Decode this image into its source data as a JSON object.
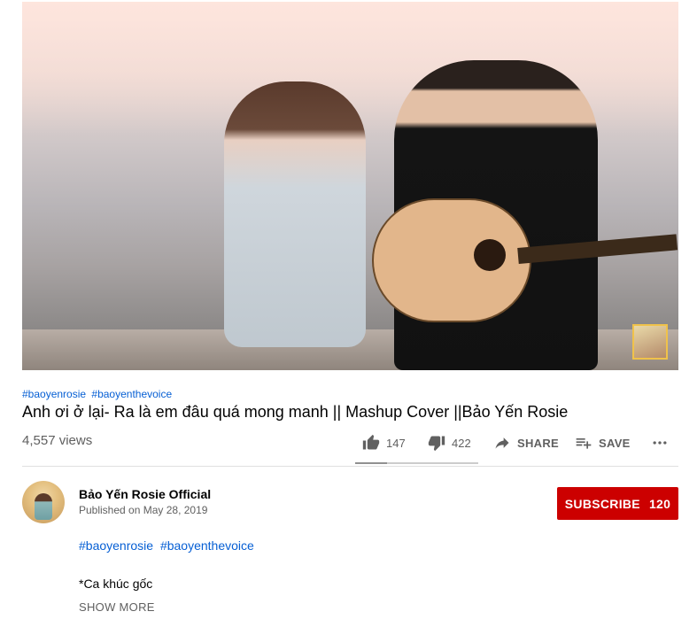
{
  "video": {
    "hashtags": [
      "#baoyenrosie",
      "#baoyenthevoice"
    ],
    "title": "Anh ơi ở lại- Ra là em đâu quá mong manh || Mashup Cover ||Bảo Yến Rosie",
    "views": "4,557 views"
  },
  "actions": {
    "like_icon": "thumb-up-icon",
    "like_count": "147",
    "dislike_icon": "thumb-down-icon",
    "dislike_count": "422",
    "share_icon": "share-icon",
    "share_label": "SHARE",
    "save_icon": "playlist-add-icon",
    "save_label": "SAVE",
    "more_icon": "more-horizontal-icon",
    "like_ratio": 0.26
  },
  "channel": {
    "name": "Bảo Yến Rosie Official",
    "published": "Published on May 28, 2019",
    "subscribe_label": "SUBSCRIBE",
    "subscriber_count": "120"
  },
  "description": {
    "hashtags": [
      "#baoyenrosie",
      "#baoyenthevoice"
    ],
    "line1": "*Ca khúc gốc",
    "show_more": "SHOW MORE"
  },
  "colors": {
    "link": "#065fd4",
    "subscribe_bg": "#cc0000",
    "secondary_text": "#606060"
  }
}
